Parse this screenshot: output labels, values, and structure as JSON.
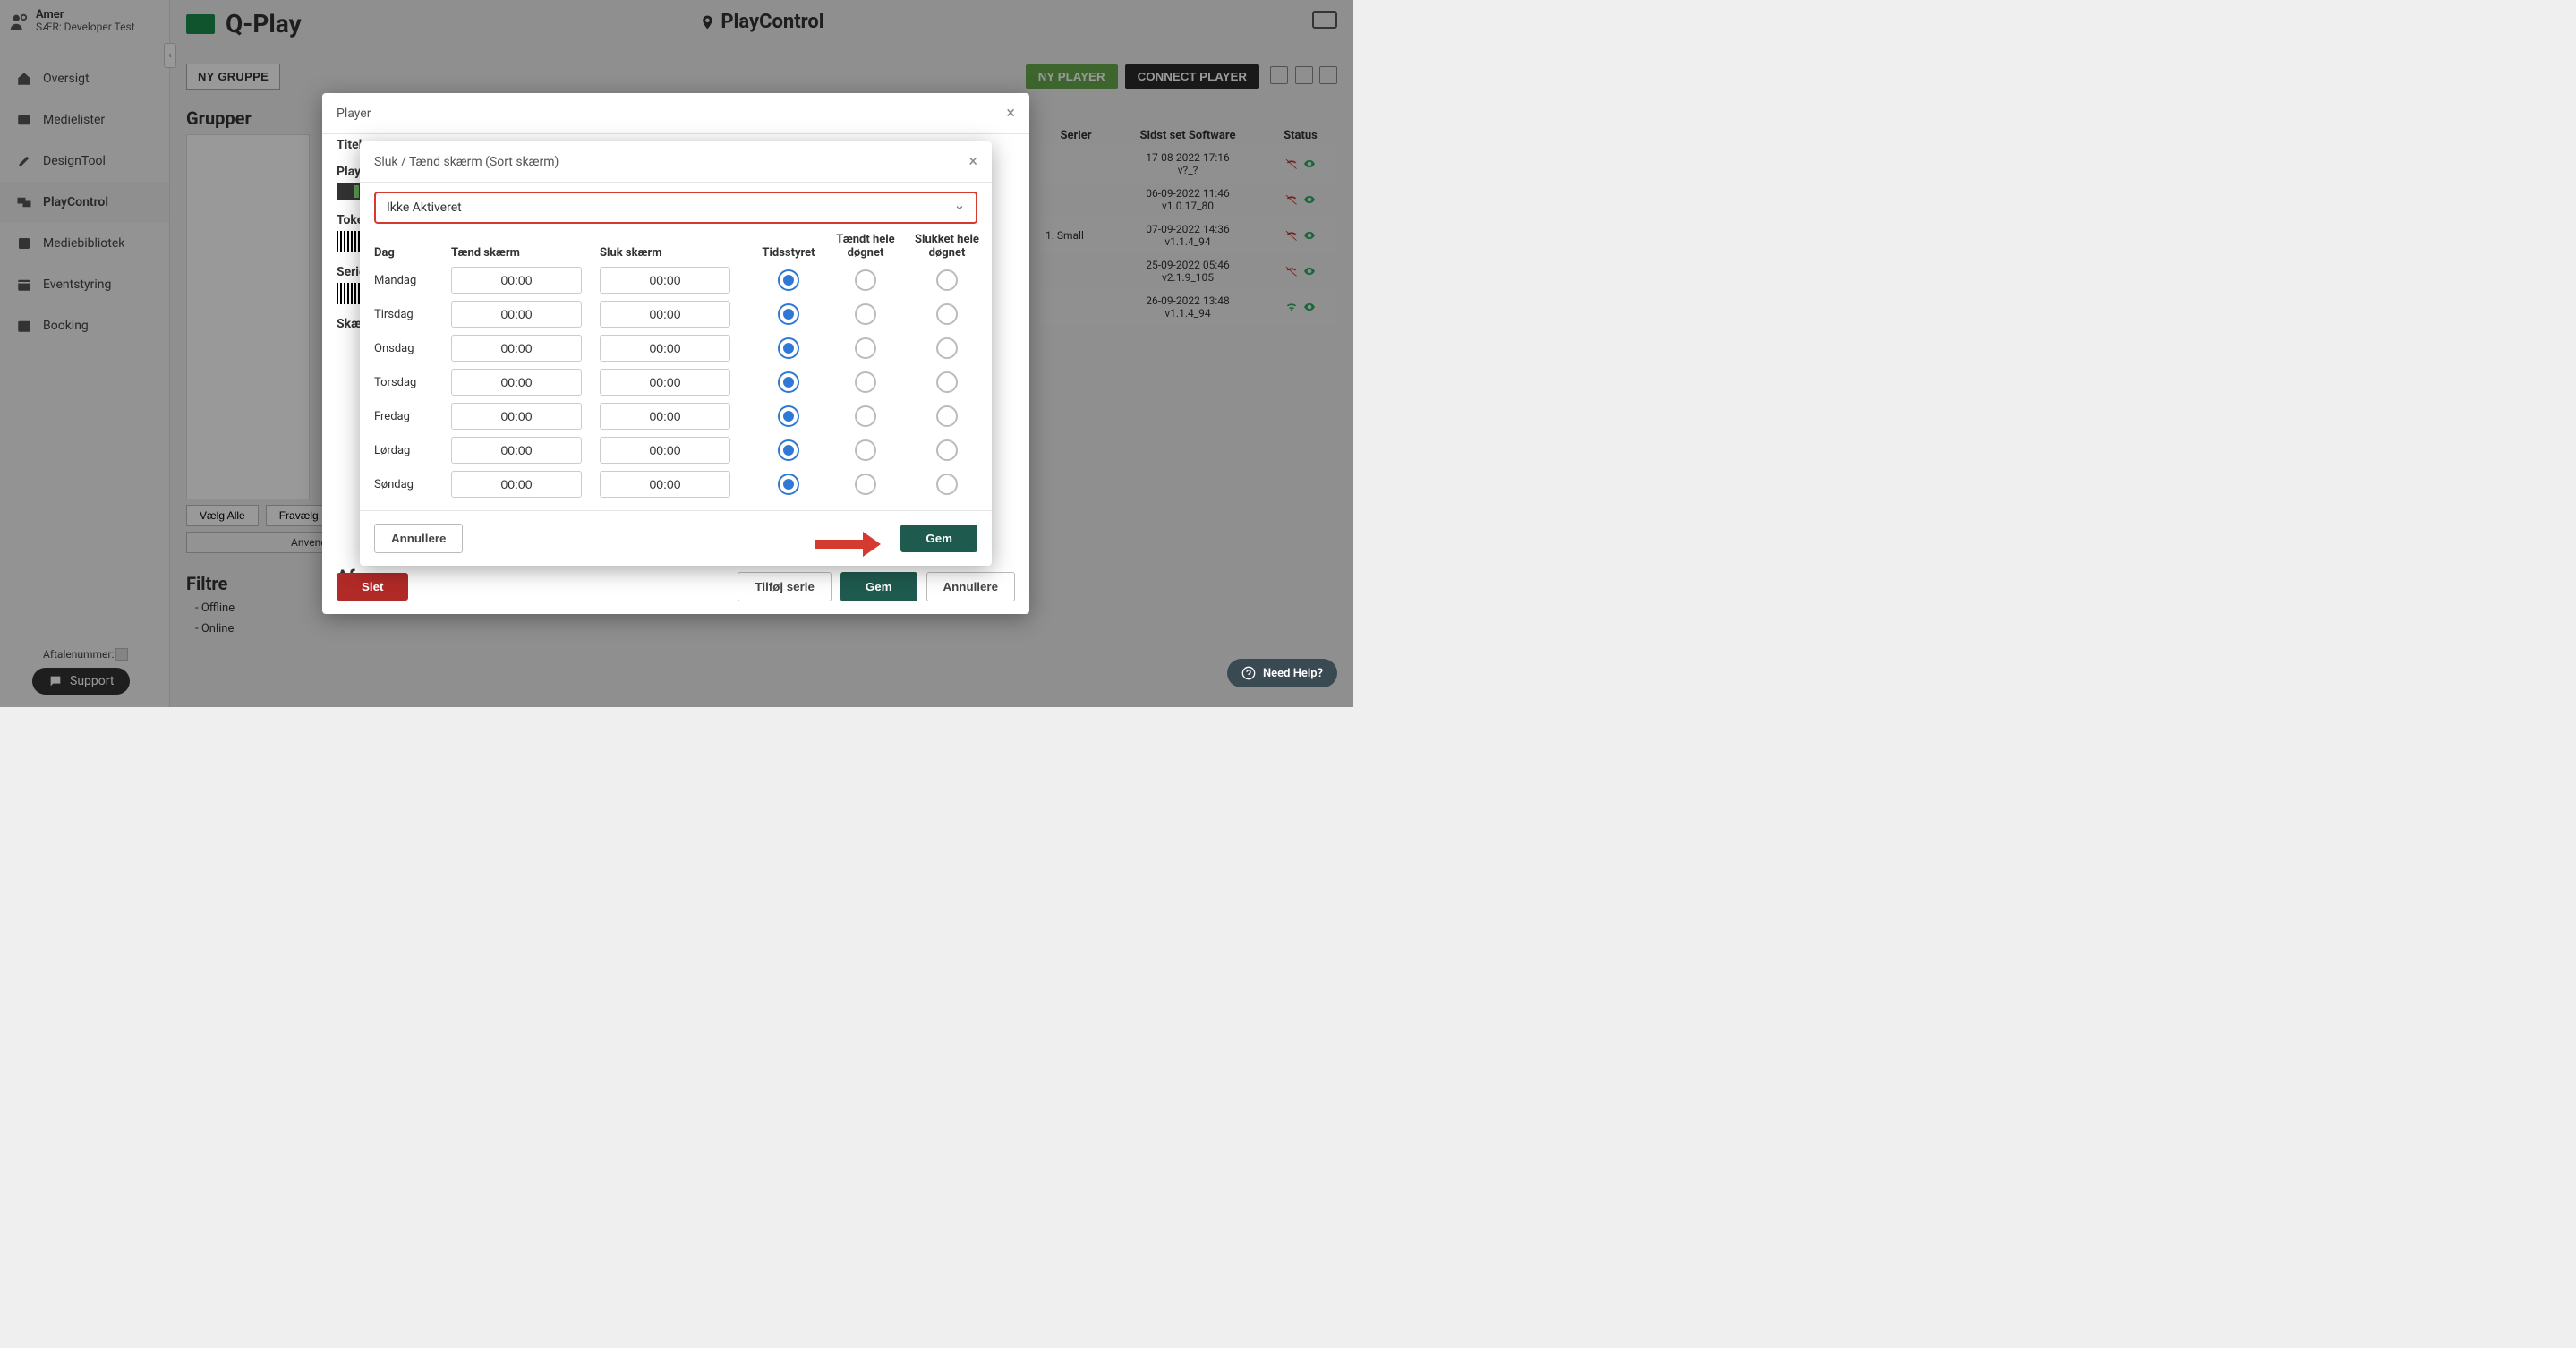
{
  "user": {
    "name": "Amer",
    "role": "SÆR: Developer Test"
  },
  "aftale_label": "Aftalenummer:",
  "support": "Support",
  "brand": "Q-Play",
  "page_title": "PlayControl",
  "toolbar": {
    "ny_gruppe": "NY GRUPPE",
    "ny_player": "NY PLAYER",
    "connect_player": "CONNECT PLAYER"
  },
  "nav": {
    "oversigt": "Oversigt",
    "medielister": "Medielister",
    "designtool": "DesignTool",
    "playcontrol": "PlayControl",
    "mediebibliotek": "Mediebibliotek",
    "eventstyring": "Eventstyring",
    "booking": "Booking"
  },
  "section_grupper": "Grupper",
  "vaelg_alle": "Vælg Alle",
  "fravaelg": "Fravælg",
  "anvend": "Anvend",
  "filtre_title": "Filtre",
  "filtre_offline": "- Offline",
  "filtre_online": "- Online",
  "ptable": {
    "h_serier": "Serier",
    "h_sidst": "Sidst set Software",
    "h_status": "Status",
    "rows": [
      {
        "serier": "",
        "dt": "17-08-2022 17:16",
        "sw": "v?_?",
        "online": true
      },
      {
        "serier": "",
        "dt": "06-09-2022 11:46",
        "sw": "v1.0.17_80",
        "online": true
      },
      {
        "serier": "1. Small",
        "dt": "07-09-2022 14:36",
        "sw": "v1.1.4_94",
        "online": true
      },
      {
        "serier": "",
        "dt": "25-09-2022 05:46",
        "sw": "v2.1.9_105",
        "online": true
      },
      {
        "serier": "",
        "dt": "26-09-2022 13:48",
        "sw": "v1.1.4_94",
        "online": true
      }
    ]
  },
  "modal1": {
    "title": "Player",
    "titel": "Titel",
    "player": "Player",
    "token": "Toke",
    "serie": "Serie",
    "skaerm": "Skæ",
    "afs": "Afs",
    "slet": "Slet",
    "tilfoj": "Tilføj serie",
    "gem": "Gem",
    "annullere": "Annullere"
  },
  "modal2": {
    "title": "Sluk / Tænd skærm (Sort skærm)",
    "dd": "Ikke Aktiveret",
    "h_dag": "Dag",
    "h_taend": "Tænd skærm",
    "h_sluk": "Sluk skærm",
    "h_tids": "Tidsstyret",
    "h_taendh": "Tændt hele døgnet",
    "h_slukh": "Slukket hele døgnet",
    "days": [
      {
        "day": "Mandag",
        "on": "00:00",
        "off": "00:00"
      },
      {
        "day": "Tirsdag",
        "on": "00:00",
        "off": "00:00"
      },
      {
        "day": "Onsdag",
        "on": "00:00",
        "off": "00:00"
      },
      {
        "day": "Torsdag",
        "on": "00:00",
        "off": "00:00"
      },
      {
        "day": "Fredag",
        "on": "00:00",
        "off": "00:00"
      },
      {
        "day": "Lørdag",
        "on": "00:00",
        "off": "00:00"
      },
      {
        "day": "Søndag",
        "on": "00:00",
        "off": "00:00"
      }
    ],
    "annullere": "Annullere",
    "gem": "Gem"
  },
  "need_help": "Need Help?"
}
